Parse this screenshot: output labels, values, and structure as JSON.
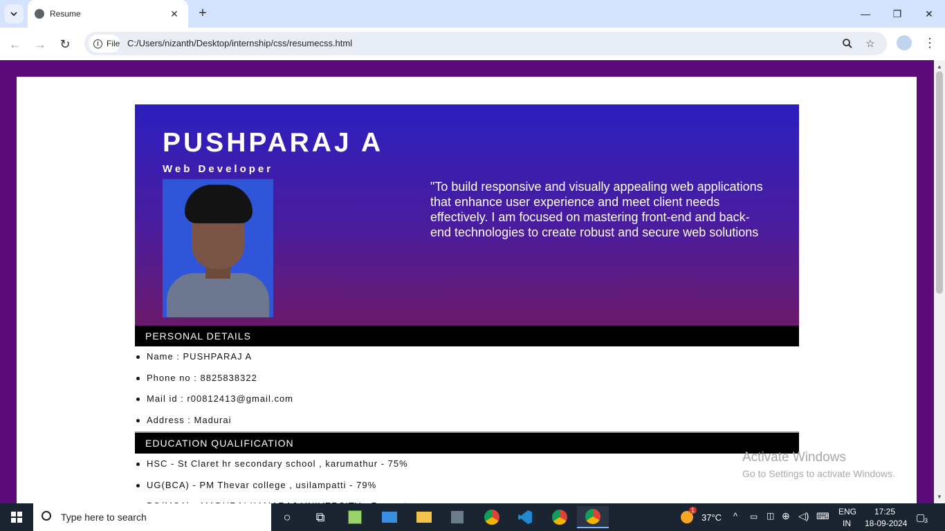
{
  "browser": {
    "tab_title": "Resume",
    "new_tab_symbol": "+",
    "security_chip_label": "File",
    "url": "C:/Users/nizanth/Desktop/internship/css/resumecss.html"
  },
  "resume": {
    "name": "PUSHPARAJ A",
    "role": "Web Developer",
    "objective": "\"To build responsive and visually appealing web applications that enhance user experience and meet client needs effectively. I am focused on mastering front-end and back-end technologies to create robust and secure web solutions",
    "personal_heading": "PERSONAL DETAILS",
    "personal": [
      "Name : PUSHPARAJ A",
      "Phone no : 8825838322",
      "Mail id : r00812413@gmail.com",
      "Address : Madurai"
    ],
    "education_heading": "EDUCATION QUALIFICATION",
    "education": [
      "HSC - St Claret hr secondary school , karumathur - 75%",
      "UG(BCA) - PM Thevar college , usilampatti - 79%",
      "PG(MCA) - MADURAI KAMARAJ UNIVERSITY - Present"
    ]
  },
  "watermark": {
    "line1": "Activate Windows",
    "line2": "Go to Settings to activate Windows."
  },
  "taskbar": {
    "search_placeholder": "Type here to search",
    "temperature": "37°C",
    "lang_line1": "ENG",
    "lang_line2": "IN",
    "time": "17:25",
    "date": "18-09-2024",
    "notification_count": "3",
    "weather_badge": "1"
  },
  "colors": {
    "page_background": "#5b0a7a",
    "hero_gradient_top": "#2c1fbf",
    "hero_gradient_bottom": "#6b1a6a",
    "section_bar": "#000000"
  }
}
